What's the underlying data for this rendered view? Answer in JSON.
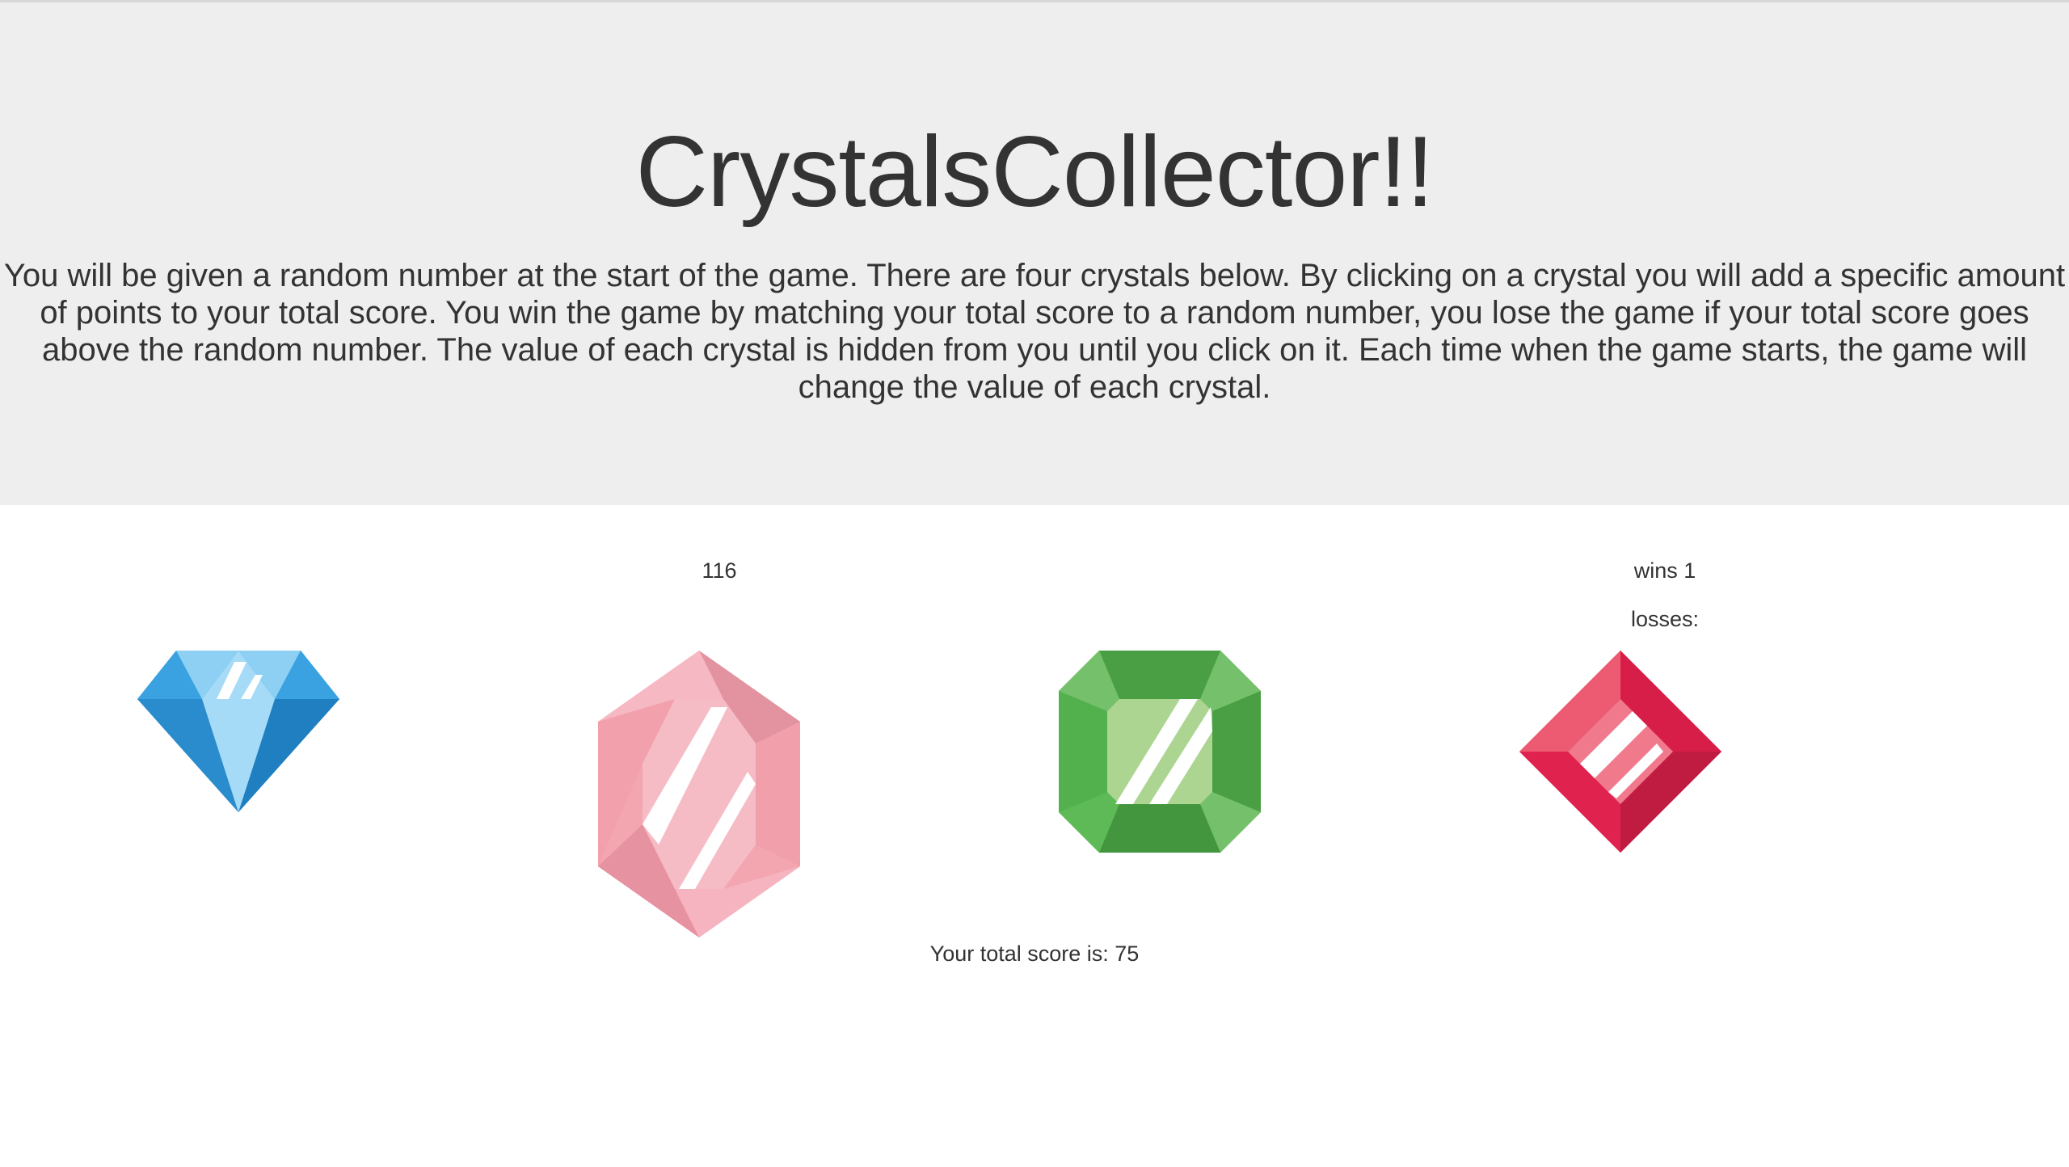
{
  "header": {
    "title": "CrystalsCollector!!",
    "instructions": "You will be given a random number at the start of the game. There are four crystals below. By clicking on a crystal you will add a specific amount of points to your total score. You win the game by matching your total score to a random number, you lose the game if your total score goes above the random number. The value of each crystal is hidden from you until you click on it. Each time when the game starts, the game will change the value of each crystal."
  },
  "game": {
    "target_number": "116",
    "wins_label": "wins 1",
    "losses_label": "losses:",
    "total_score_label": "Your total score is: 75"
  },
  "crystals": [
    {
      "name": "blue-diamond-crystal",
      "color": "#2e94d4"
    },
    {
      "name": "pink-hexagon-crystal",
      "color": "#f3a9b1"
    },
    {
      "name": "green-octagon-crystal",
      "color": "#55b24f"
    },
    {
      "name": "red-rhombus-crystal",
      "color": "#e22350"
    }
  ],
  "colors": {
    "header_background": "#eeeeee",
    "page_background": "#ffffff",
    "text": "#333333"
  }
}
